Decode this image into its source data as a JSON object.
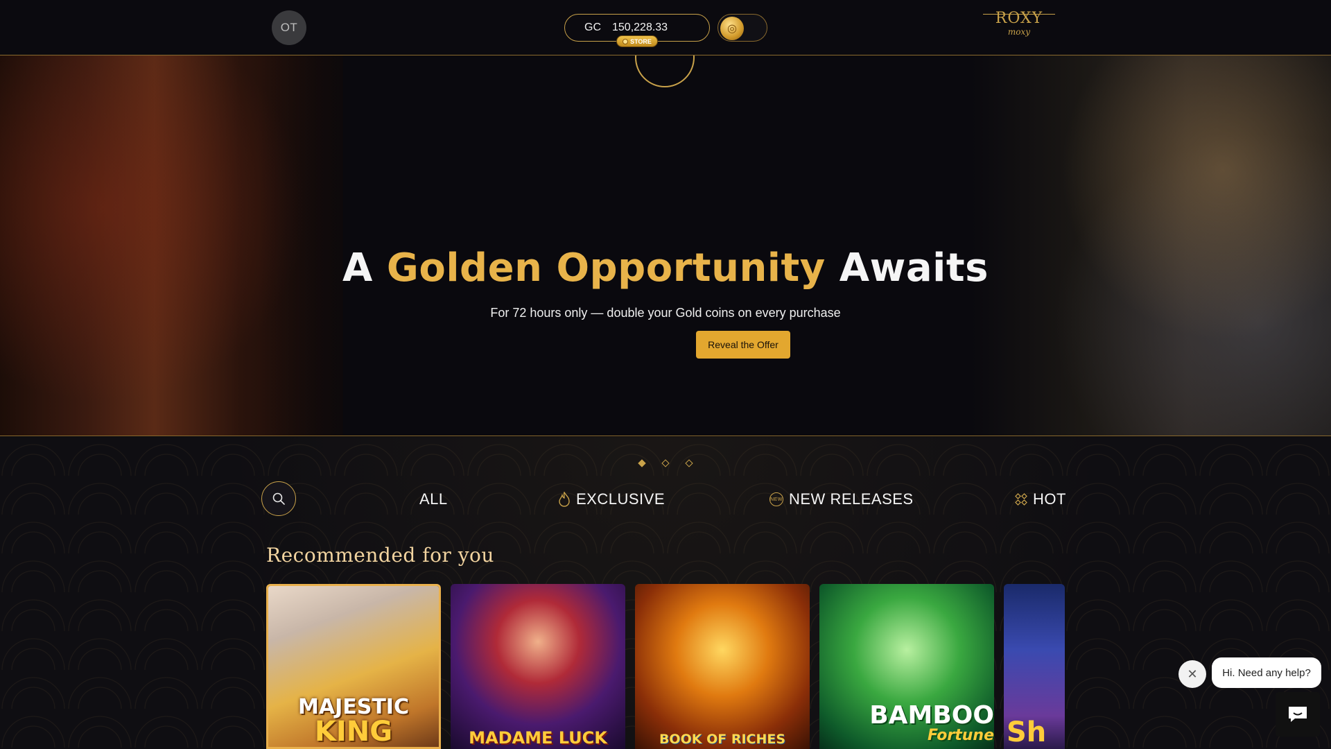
{
  "header": {
    "avatar_initials": "OT",
    "currency_code": "GC",
    "balance": "150,228.33",
    "store_label": "STORE",
    "logo_line1": "ROXY",
    "logo_line2": "moxy"
  },
  "hero": {
    "title_part1": "A",
    "title_gold": "Golden Opportunity",
    "title_part2": "Awaits",
    "subtitle": "For 72 hours only — double your Gold coins on every purchase",
    "cta_label": "Reveal the Offer"
  },
  "carousel": {
    "slides": 3,
    "active_index": 0
  },
  "categories": [
    {
      "label": "ALL",
      "icon": ""
    },
    {
      "label": "EXCLUSIVE",
      "icon": "flame-icon"
    },
    {
      "label": "NEW RELEASES",
      "icon": "new-badge-icon",
      "icon_text": "NEW"
    },
    {
      "label": "HOT",
      "icon": "grid-diamond-icon"
    }
  ],
  "section_title": "Recommended for you",
  "games": [
    {
      "title_line1": "MAJESTIC",
      "title_line2": "KING"
    },
    {
      "title_line1": "MADAME LUCK"
    },
    {
      "title_line1": "BOOK OF RICHES"
    },
    {
      "title_line1": "BAMBOO",
      "title_line2": "Fortune"
    },
    {
      "title_line1": "Sh"
    }
  ],
  "chat": {
    "greeting": "Hi. Need any help?"
  },
  "colors": {
    "accent_gold": "#c9a24a",
    "cta_gold": "#e3a72f",
    "background": "#0b0a0f"
  }
}
